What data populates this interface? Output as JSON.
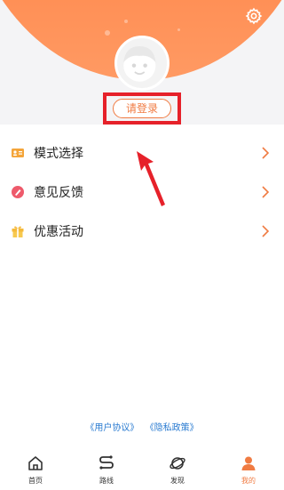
{
  "profile": {
    "login_label": "请登录"
  },
  "menu": {
    "items": [
      {
        "label": "模式选择",
        "icon": "id-card-icon"
      },
      {
        "label": "意见反馈",
        "icon": "feedback-icon"
      },
      {
        "label": "优惠活动",
        "icon": "gift-icon"
      }
    ]
  },
  "footer": {
    "user_agreement": "《用户协议》",
    "privacy_policy": "《隐私政策》"
  },
  "tabbar": {
    "tabs": [
      {
        "label": "首页",
        "icon": "home-icon",
        "active": false
      },
      {
        "label": "路线",
        "icon": "route-icon",
        "active": false
      },
      {
        "label": "发现",
        "icon": "planet-icon",
        "active": false
      },
      {
        "label": "我的",
        "icon": "person-icon",
        "active": true
      }
    ]
  },
  "colors": {
    "accent": "#f07b42",
    "header_gradient_start": "#ff6a3d",
    "highlight_box": "#e6212a",
    "link": "#2a7bd1"
  }
}
